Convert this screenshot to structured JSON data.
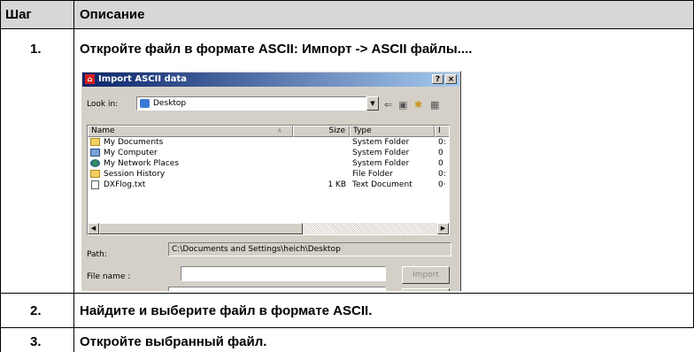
{
  "table": {
    "header": {
      "col_step": "Шаг",
      "col_desc": "Описание"
    },
    "rows": [
      {
        "step": "1.",
        "desc": "Откройте файл в формате ASCII: Импорт -> ASCII файлы...."
      },
      {
        "step": "2.",
        "desc": "Найдите и выберите файл в формате ASCII."
      },
      {
        "step": "3.",
        "desc": "Откройте выбранный файл."
      }
    ]
  },
  "dialog": {
    "title": "Import ASCII data",
    "help_btn": "?",
    "close_btn": "×",
    "look_in_label": "Look in:",
    "look_in_value": "Desktop",
    "toolbar": {
      "back": "⇐",
      "up": "▣",
      "new_folder": "✱",
      "view": "▦"
    },
    "columns": {
      "name": "Name",
      "size": "Size",
      "type": "Type",
      "more": "I"
    },
    "files": [
      {
        "name": "My Documents",
        "size": "",
        "type": "System Folder",
        "extra": "0:",
        "icon": "folder"
      },
      {
        "name": "My Computer",
        "size": "",
        "type": "System Folder",
        "extra": "0",
        "icon": "computer"
      },
      {
        "name": "My Network Places",
        "size": "",
        "type": "System Folder",
        "extra": "0",
        "icon": "network"
      },
      {
        "name": "Session History",
        "size": "",
        "type": "File Folder",
        "extra": "0:",
        "icon": "folder"
      },
      {
        "name": "DXFlog.txt",
        "size": "1 KB",
        "type": "Text Document",
        "extra": "0·",
        "icon": "file"
      }
    ],
    "path_label": "Path:",
    "path_value": "C:\\Documents and Settings\\heich\\Desktop",
    "filename_label": "File name :",
    "filename_value": "",
    "import_btn": "Import"
  }
}
